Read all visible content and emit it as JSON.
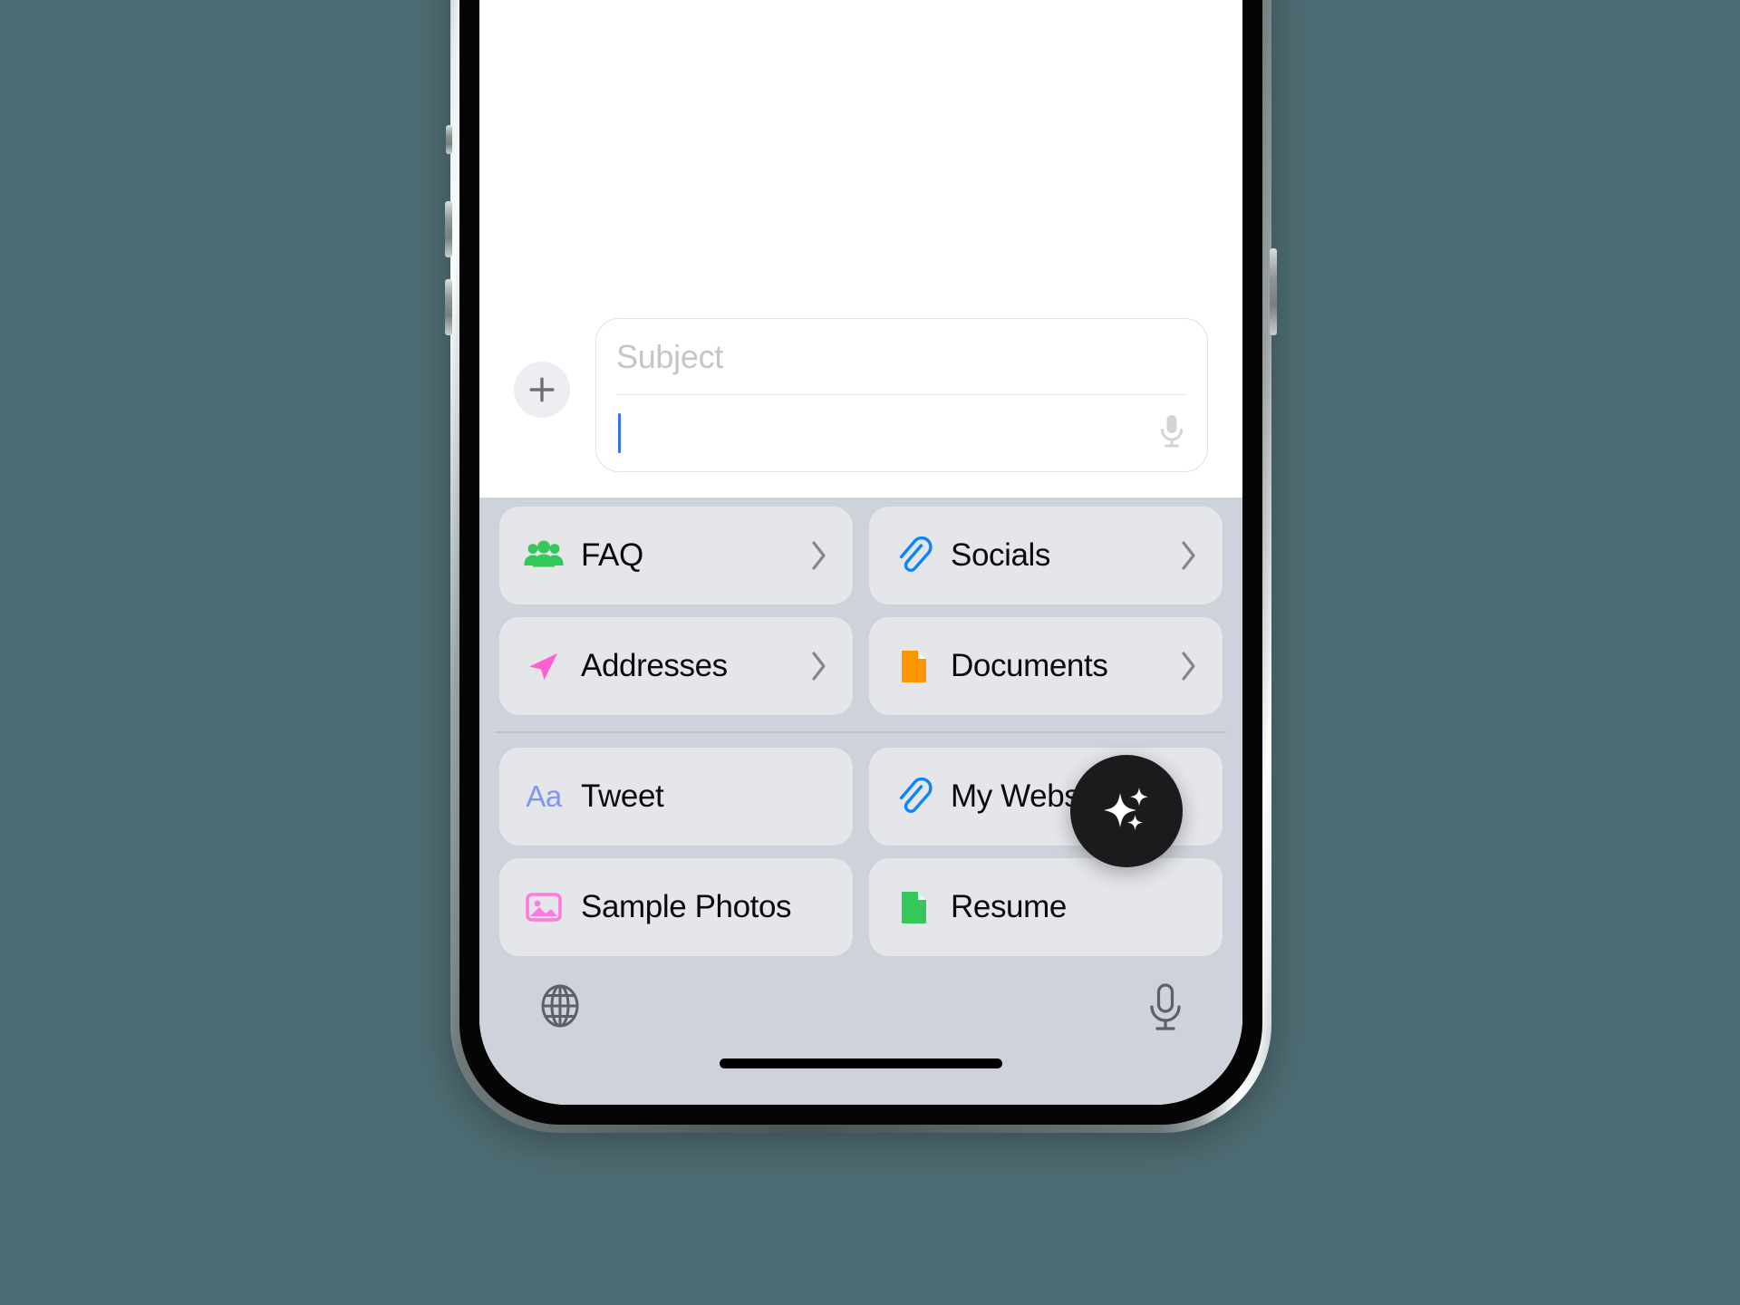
{
  "device": {
    "name": "iphone-frame",
    "buttons": [
      "silent-switch",
      "volume-up-button",
      "volume-down-button",
      "power-button"
    ]
  },
  "compose": {
    "plus_icon": "plus-icon",
    "subject_placeholder": "Subject",
    "body_value": "",
    "body_placeholder": "",
    "caret_color": "#3b6ef5",
    "mic_icon": "microphone-icon"
  },
  "suggestions": {
    "groups": [
      {
        "rows": [
          {
            "chips": [
              {
                "label": "FAQ",
                "icon": "people-group-icon",
                "icon_color": "#34c759",
                "chevron": true
              },
              {
                "label": "Socials",
                "icon": "paperclip-icon",
                "icon_color": "#0a84ff",
                "chevron": true
              }
            ]
          },
          {
            "chips": [
              {
                "label": "Addresses",
                "icon": "location-arrow-icon",
                "icon_color": "#ff5fd2",
                "chevron": true
              },
              {
                "label": "Documents",
                "icon": "document-icon",
                "icon_color": "#ff9500",
                "chevron": true
              }
            ]
          }
        ]
      },
      {
        "rows": [
          {
            "chips": [
              {
                "label": "Tweet",
                "icon": "text-format-aa-icon",
                "icon_text": "Aa",
                "icon_color": "#7f97f0",
                "chevron": false
              },
              {
                "label": "My Website",
                "icon": "paperclip-icon",
                "icon_color": "#0a84ff",
                "chevron": false
              }
            ]
          },
          {
            "chips": [
              {
                "label": "Sample Photos",
                "icon": "photo-icon",
                "icon_color": "#ff7ae0",
                "chevron": false
              },
              {
                "label": "Resume",
                "icon": "document-icon",
                "icon_color": "#34c759",
                "chevron": false
              }
            ]
          }
        ]
      }
    ]
  },
  "ai_button": {
    "name": "ai-sparkle-button",
    "icon": "sparkles-icon",
    "background": "#1b1b1d"
  },
  "keyboard_bar": {
    "globe_icon": "globe-icon",
    "mic_icon": "microphone-icon",
    "home_indicator": "home-indicator"
  },
  "colors": {
    "page_background": "#4d6b72",
    "panel_background": "#ced2da",
    "chip_background": "#e5e6ea",
    "accent_blue": "#0a84ff"
  }
}
